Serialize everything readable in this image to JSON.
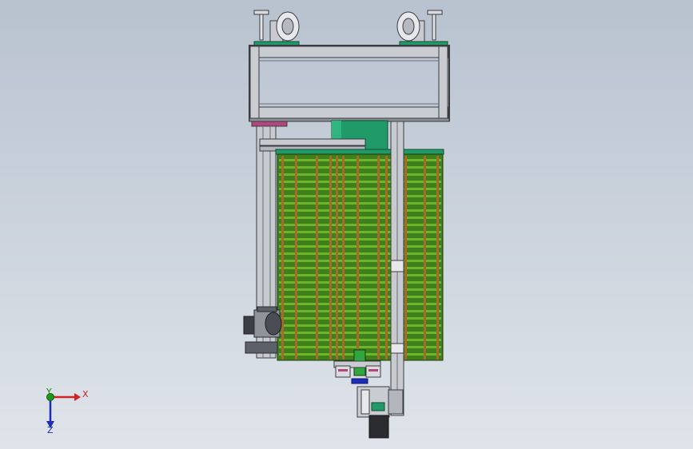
{
  "app": {
    "window_title": ""
  },
  "viewport": {
    "background_top": "#b8c2cf",
    "background_bottom": "#dfe4ea",
    "model": {
      "frame_color": "#c9ccd1",
      "frame_outline": "#3a3d42",
      "plate_color": "#1f9a68",
      "rack_color": "#3f7f1c",
      "rack_shelf_color": "#6db52b",
      "post_color": "#a86a2a",
      "caster_color": "#d9dbdf",
      "accent_magenta": "#b1477e"
    }
  },
  "triad": {
    "x_label": "X",
    "y_label": "Y",
    "z_label": "Z",
    "x_color": "#d22222",
    "y_color": "#1a9a1a",
    "z_color": "#1c2cb8"
  }
}
